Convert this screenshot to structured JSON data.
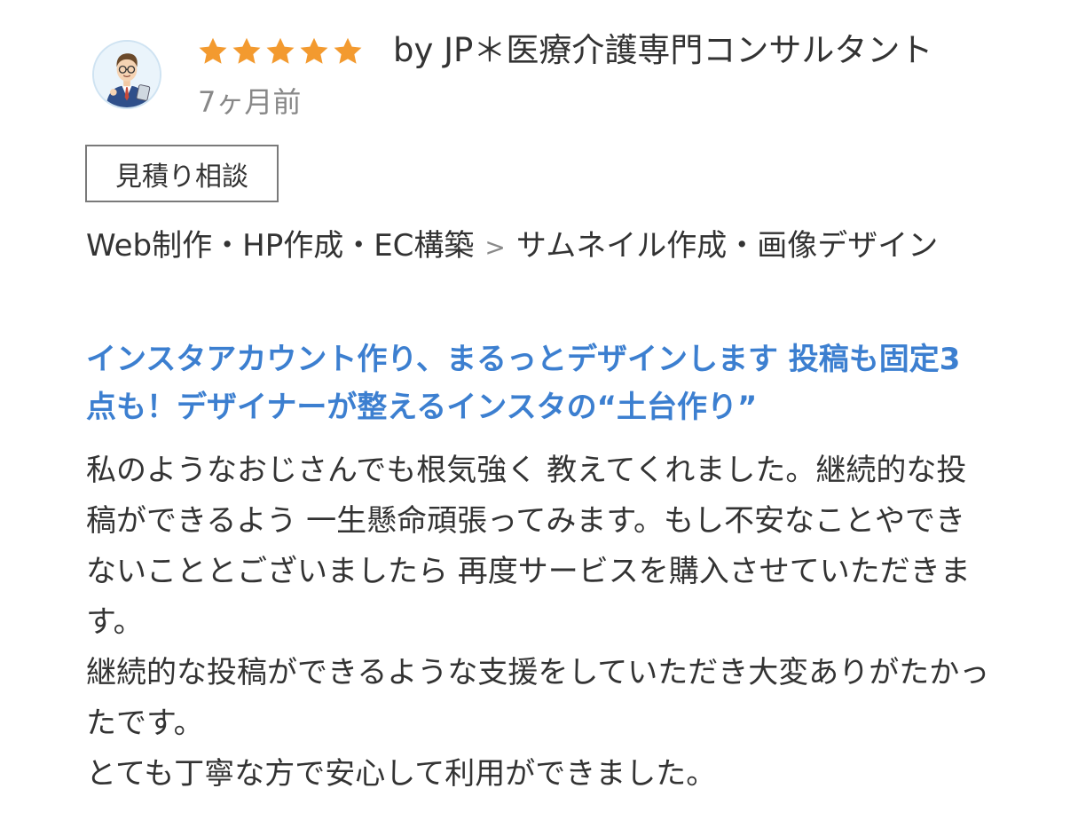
{
  "review": {
    "rating": 5,
    "rating_max": 5,
    "star_color": "#f39a2f",
    "author": "by JP＊医療介護専門コンサルタント",
    "time_ago": "7ヶ月前",
    "badge": "見積り相談",
    "category": {
      "parent": "Web制作・HP作成・EC構築",
      "separator": ">",
      "child": "サムネイル作成・画像デザイン"
    },
    "service_title": "インスタアカウント作り、まるっとデザインします 投稿も固定3点も！デザイナーが整えるインスタの“土台作り”",
    "service_title_color": "#3c7fd0",
    "body": [
      "私のようなおじさんでも根気強く 教えてくれました。継続的な投稿ができるよう 一生懸命頑張ってみます。もし不安なことやできないこととございましたら 再度サービスを購入させていただきます。",
      "継続的な投稿ができるような支援をしていただき大変ありがたかったです。",
      "とても丁寧な方で安心して利用ができました。"
    ]
  }
}
